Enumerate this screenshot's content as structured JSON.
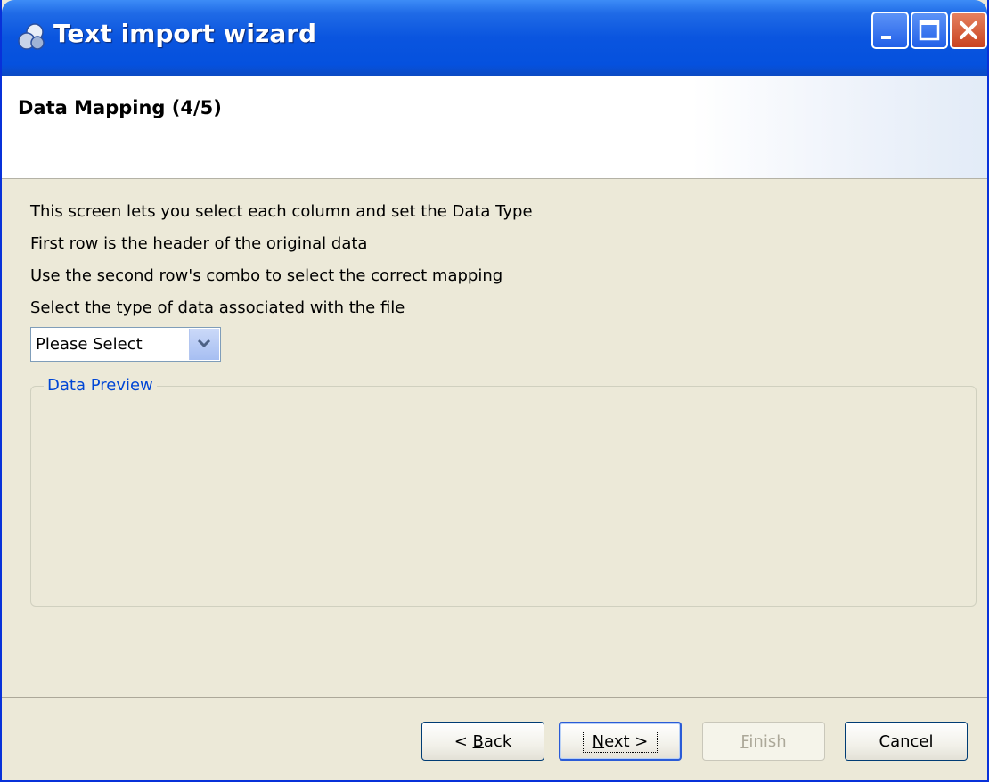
{
  "window": {
    "title": "Text import wizard"
  },
  "header": {
    "title": "Data Mapping (4/5)"
  },
  "instructions": [
    "This screen lets you select each column and set the Data Type",
    "First row is the header of the original data",
    "Use the second row's combo to select the correct mapping",
    "Select the type of data associated with the file"
  ],
  "data_type_select": {
    "value": "Please Select"
  },
  "preview_group": {
    "label": "Data Preview"
  },
  "buttons": {
    "back": {
      "before": "< ",
      "mnemonic": "B",
      "after": "ack"
    },
    "next": {
      "before": "",
      "mnemonic": "N",
      "after": "ext >"
    },
    "finish": {
      "before": "",
      "mnemonic": "F",
      "after": "inish"
    },
    "cancel": "Cancel"
  },
  "colors": {
    "titlebar": "#0a55df",
    "window_bg": "#ece9d8",
    "group_label": "#0046d5",
    "close_button": "#c94320"
  },
  "icons": {
    "app": "app-icon",
    "minimize": "minimize-icon",
    "maximize": "maximize-icon",
    "close": "close-icon",
    "dropdown": "chevron-down-icon"
  }
}
